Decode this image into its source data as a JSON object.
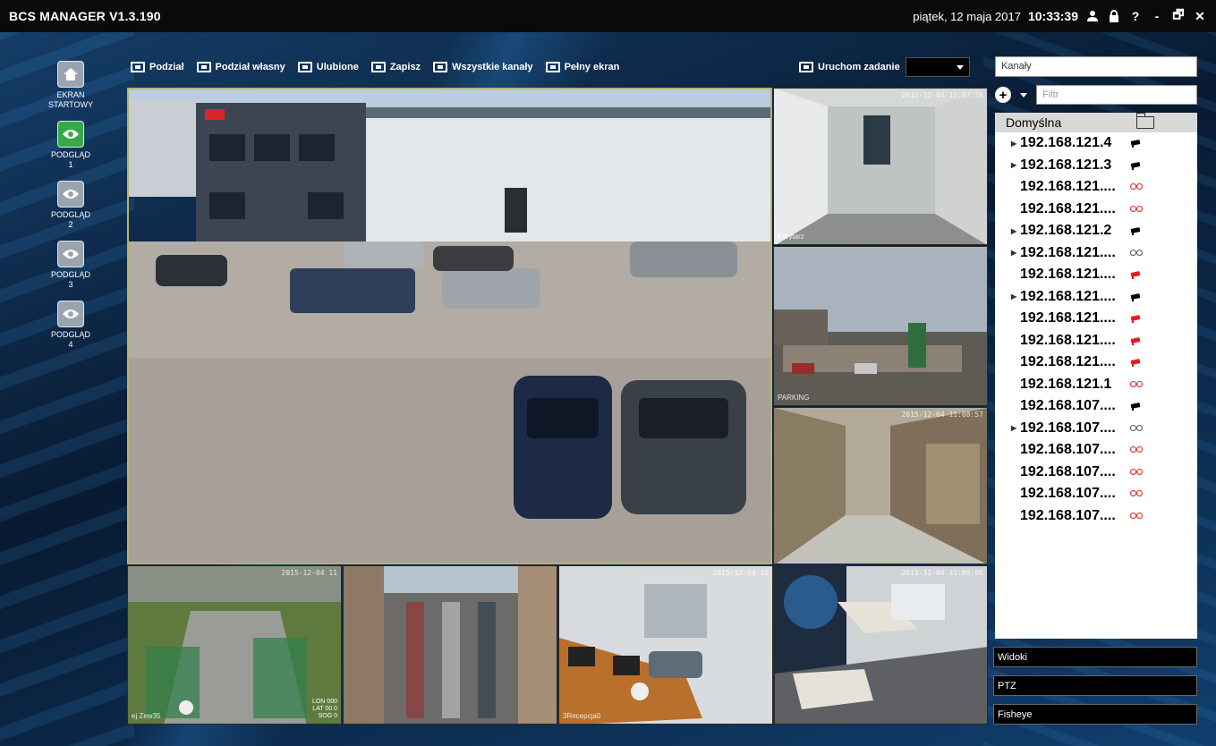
{
  "app": {
    "title": "BCS MANAGER V1.3.190"
  },
  "titlebar": {
    "date": "piątek, 12 maja 2017",
    "time": "10:33:39",
    "icons": [
      "user-icon",
      "lock-icon",
      "help-icon",
      "minimize-icon",
      "restore-icon",
      "close-icon"
    ],
    "help_glyph": "?",
    "minimize_glyph": "-",
    "restore_glyph": "🗗",
    "close_glyph": "✕"
  },
  "sidebar": {
    "items": [
      {
        "label_line1": "EKRAN",
        "label_line2": "STARTOWY",
        "icon": "home-icon",
        "active": false
      },
      {
        "label_line1": "PODGLĄD",
        "label_line2": "1",
        "icon": "eye-icon",
        "active": true
      },
      {
        "label_line1": "PODGLĄD",
        "label_line2": "2",
        "icon": "eye-icon",
        "active": false
      },
      {
        "label_line1": "PODGLĄD",
        "label_line2": "3",
        "icon": "eye-icon",
        "active": false
      },
      {
        "label_line1": "PODGLĄD",
        "label_line2": "4",
        "icon": "eye-icon",
        "active": false
      }
    ]
  },
  "toolbar": {
    "podzial": "Podział",
    "podzial_wlasny": "Podział własny",
    "ulubione": "Ulubione",
    "zapisz": "Zapisz",
    "wszystkie_kanaly": "Wszystkie kanały",
    "pelny_ekran": "Pełny ekran",
    "uruchom_zadanie": "Uruchom zadanie"
  },
  "cameras": {
    "main": {
      "timestamp": ""
    },
    "cam2": {
      "timestamp": "2015-12-04 11:07:38",
      "name": "Korytarz"
    },
    "cam3": {
      "timestamp": "",
      "name": "PARKING"
    },
    "cam4": {
      "timestamp": "2015-12-04 11:08:57",
      "name": ""
    },
    "cam5": {
      "timestamp": "2015-12-04 11",
      "name": "ej Zew35",
      "overlay1": "LON 000",
      "overlay2": "LAT 00.0",
      "overlay3": "SOG 0"
    },
    "cam6": {
      "timestamp": "",
      "name": ""
    },
    "cam7": {
      "timestamp": "2015-12-04 11",
      "name": "3Recepcja0"
    },
    "cam8": {
      "timestamp": "2015-12-04 11:09:06",
      "name": ""
    }
  },
  "rightpanel": {
    "channels_placeholder": "Kanały",
    "filter_placeholder": "Filtr",
    "group": "Domyślna",
    "channels": [
      {
        "ip": "192.168.121.4",
        "arrow": true,
        "status": "cam-black"
      },
      {
        "ip": "192.168.121.3",
        "arrow": true,
        "status": "cam-black"
      },
      {
        "ip": "192.168.121....",
        "arrow": false,
        "status": "tape-red"
      },
      {
        "ip": "192.168.121....",
        "arrow": false,
        "status": "tape-red"
      },
      {
        "ip": "192.168.121.2",
        "arrow": true,
        "status": "cam-black"
      },
      {
        "ip": "192.168.121....",
        "arrow": true,
        "status": "tape-gray"
      },
      {
        "ip": "192.168.121....",
        "arrow": false,
        "status": "cam-red"
      },
      {
        "ip": "192.168.121....",
        "arrow": true,
        "status": "cam-black"
      },
      {
        "ip": "192.168.121....",
        "arrow": false,
        "status": "cam-red"
      },
      {
        "ip": "192.168.121....",
        "arrow": false,
        "status": "cam-red"
      },
      {
        "ip": "192.168.121....",
        "arrow": false,
        "status": "cam-red"
      },
      {
        "ip": "192.168.121.1",
        "arrow": false,
        "status": "tape-red"
      },
      {
        "ip": "192.168.107....",
        "arrow": false,
        "status": "cam-black"
      },
      {
        "ip": "192.168.107....",
        "arrow": true,
        "status": "tape-gray"
      },
      {
        "ip": "192.168.107....",
        "arrow": false,
        "status": "tape-red"
      },
      {
        "ip": "192.168.107....",
        "arrow": false,
        "status": "tape-red"
      },
      {
        "ip": "192.168.107....",
        "arrow": false,
        "status": "tape-red"
      },
      {
        "ip": "192.168.107....",
        "arrow": false,
        "status": "tape-red"
      }
    ],
    "widoki": "Widoki",
    "ptz": "PTZ",
    "fisheye": "Fisheye"
  }
}
